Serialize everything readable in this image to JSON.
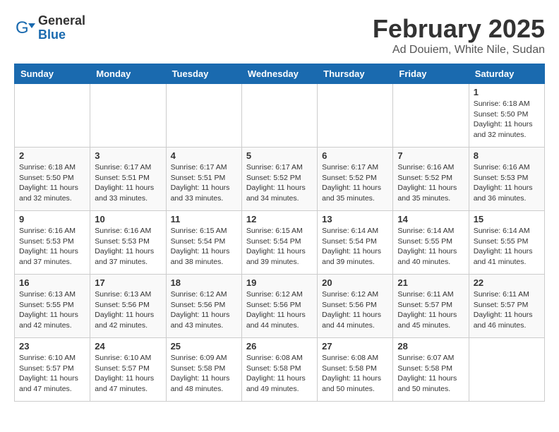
{
  "logo": {
    "general": "General",
    "blue": "Blue"
  },
  "title": "February 2025",
  "location": "Ad Douiem, White Nile, Sudan",
  "days_of_week": [
    "Sunday",
    "Monday",
    "Tuesday",
    "Wednesday",
    "Thursday",
    "Friday",
    "Saturday"
  ],
  "weeks": [
    [
      {
        "day": "",
        "info": ""
      },
      {
        "day": "",
        "info": ""
      },
      {
        "day": "",
        "info": ""
      },
      {
        "day": "",
        "info": ""
      },
      {
        "day": "",
        "info": ""
      },
      {
        "day": "",
        "info": ""
      },
      {
        "day": "1",
        "sunrise": "6:18 AM",
        "sunset": "5:50 PM",
        "daylight": "11 hours and 32 minutes."
      }
    ],
    [
      {
        "day": "2",
        "sunrise": "6:18 AM",
        "sunset": "5:50 PM",
        "daylight": "11 hours and 32 minutes."
      },
      {
        "day": "3",
        "sunrise": "6:17 AM",
        "sunset": "5:51 PM",
        "daylight": "11 hours and 33 minutes."
      },
      {
        "day": "4",
        "sunrise": "6:17 AM",
        "sunset": "5:51 PM",
        "daylight": "11 hours and 33 minutes."
      },
      {
        "day": "5",
        "sunrise": "6:17 AM",
        "sunset": "5:52 PM",
        "daylight": "11 hours and 34 minutes."
      },
      {
        "day": "6",
        "sunrise": "6:17 AM",
        "sunset": "5:52 PM",
        "daylight": "11 hours and 35 minutes."
      },
      {
        "day": "7",
        "sunrise": "6:16 AM",
        "sunset": "5:52 PM",
        "daylight": "11 hours and 35 minutes."
      },
      {
        "day": "8",
        "sunrise": "6:16 AM",
        "sunset": "5:53 PM",
        "daylight": "11 hours and 36 minutes."
      }
    ],
    [
      {
        "day": "9",
        "sunrise": "6:16 AM",
        "sunset": "5:53 PM",
        "daylight": "11 hours and 37 minutes."
      },
      {
        "day": "10",
        "sunrise": "6:16 AM",
        "sunset": "5:53 PM",
        "daylight": "11 hours and 37 minutes."
      },
      {
        "day": "11",
        "sunrise": "6:15 AM",
        "sunset": "5:54 PM",
        "daylight": "11 hours and 38 minutes."
      },
      {
        "day": "12",
        "sunrise": "6:15 AM",
        "sunset": "5:54 PM",
        "daylight": "11 hours and 39 minutes."
      },
      {
        "day": "13",
        "sunrise": "6:14 AM",
        "sunset": "5:54 PM",
        "daylight": "11 hours and 39 minutes."
      },
      {
        "day": "14",
        "sunrise": "6:14 AM",
        "sunset": "5:55 PM",
        "daylight": "11 hours and 40 minutes."
      },
      {
        "day": "15",
        "sunrise": "6:14 AM",
        "sunset": "5:55 PM",
        "daylight": "11 hours and 41 minutes."
      }
    ],
    [
      {
        "day": "16",
        "sunrise": "6:13 AM",
        "sunset": "5:55 PM",
        "daylight": "11 hours and 42 minutes."
      },
      {
        "day": "17",
        "sunrise": "6:13 AM",
        "sunset": "5:56 PM",
        "daylight": "11 hours and 42 minutes."
      },
      {
        "day": "18",
        "sunrise": "6:12 AM",
        "sunset": "5:56 PM",
        "daylight": "11 hours and 43 minutes."
      },
      {
        "day": "19",
        "sunrise": "6:12 AM",
        "sunset": "5:56 PM",
        "daylight": "11 hours and 44 minutes."
      },
      {
        "day": "20",
        "sunrise": "6:12 AM",
        "sunset": "5:56 PM",
        "daylight": "11 hours and 44 minutes."
      },
      {
        "day": "21",
        "sunrise": "6:11 AM",
        "sunset": "5:57 PM",
        "daylight": "11 hours and 45 minutes."
      },
      {
        "day": "22",
        "sunrise": "6:11 AM",
        "sunset": "5:57 PM",
        "daylight": "11 hours and 46 minutes."
      }
    ],
    [
      {
        "day": "23",
        "sunrise": "6:10 AM",
        "sunset": "5:57 PM",
        "daylight": "11 hours and 47 minutes."
      },
      {
        "day": "24",
        "sunrise": "6:10 AM",
        "sunset": "5:57 PM",
        "daylight": "11 hours and 47 minutes."
      },
      {
        "day": "25",
        "sunrise": "6:09 AM",
        "sunset": "5:58 PM",
        "daylight": "11 hours and 48 minutes."
      },
      {
        "day": "26",
        "sunrise": "6:08 AM",
        "sunset": "5:58 PM",
        "daylight": "11 hours and 49 minutes."
      },
      {
        "day": "27",
        "sunrise": "6:08 AM",
        "sunset": "5:58 PM",
        "daylight": "11 hours and 50 minutes."
      },
      {
        "day": "28",
        "sunrise": "6:07 AM",
        "sunset": "5:58 PM",
        "daylight": "11 hours and 50 minutes."
      },
      {
        "day": "",
        "info": ""
      }
    ]
  ]
}
